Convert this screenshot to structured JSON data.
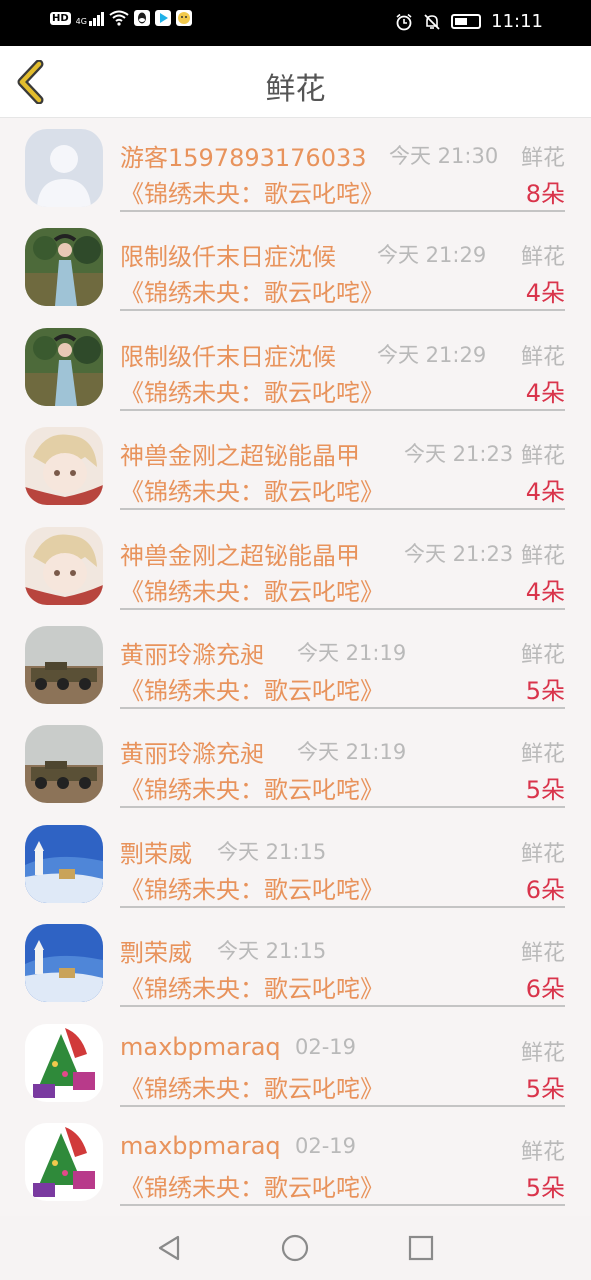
{
  "status_bar": {
    "network_type": "HD",
    "signal_label": "4G",
    "time": "11:11",
    "colors": {
      "qq_icon": "#1d1d1d",
      "video_icon": "#1fb1e8",
      "miniapp_icon": "#f2c94c"
    }
  },
  "header": {
    "title": "鲜花",
    "back_icon": "chevron-left-icon",
    "accent": "#e3bd2d"
  },
  "entries": [
    {
      "avatar": "default-user-avatar",
      "nickname": "游客1597893176033",
      "time": "今天 21:30",
      "gift_type": "鲜花",
      "book": "《锦绣未央：歌云叱咤》",
      "count": "8朵"
    },
    {
      "avatar": "costume-girl-photo-avatar",
      "nickname": "限制级仟末日症沈候",
      "time": "今天 21:29",
      "gift_type": "鲜花",
      "book": "《锦绣未央：歌云叱咤》",
      "count": "4朵"
    },
    {
      "avatar": "costume-girl-photo-avatar",
      "nickname": "限制级仟末日症沈候",
      "time": "今天 21:29",
      "gift_type": "鲜花",
      "book": "《锦绣未央：歌云叱咤》",
      "count": "4朵"
    },
    {
      "avatar": "anime-boy-avatar",
      "nickname": "神兽金刚之超铋能晶甲",
      "time": "今天 21:23",
      "gift_type": "鲜花",
      "book": "《锦绣未央：歌云叱咤》",
      "count": "4朵"
    },
    {
      "avatar": "anime-boy-avatar",
      "nickname": "神兽金刚之超铋能晶甲",
      "time": "今天 21:23",
      "gift_type": "鲜花",
      "book": "《锦绣未央：歌云叱咤》",
      "count": "4朵"
    },
    {
      "avatar": "armored-vehicle-avatar",
      "nickname": "黄丽玲滁充昶",
      "time": "今天 21:19",
      "gift_type": "鲜花",
      "book": "《锦绣未央：歌云叱咤》",
      "count": "5朵"
    },
    {
      "avatar": "armored-vehicle-avatar",
      "nickname": "黄丽玲滁充昶",
      "time": "今天 21:19",
      "gift_type": "鲜花",
      "book": "《锦绣未央：歌云叱咤》",
      "count": "5朵"
    },
    {
      "avatar": "snowy-village-avatar",
      "nickname": "剽荣威",
      "time": "今天 21:15",
      "gift_type": "鲜花",
      "book": "《锦绣未央：歌云叱咤》",
      "count": "6朵"
    },
    {
      "avatar": "snowy-village-avatar",
      "nickname": "剽荣威",
      "time": "今天 21:15",
      "gift_type": "鲜花",
      "book": "《锦绣未央：歌云叱咤》",
      "count": "6朵"
    },
    {
      "avatar": "christmas-tree-avatar",
      "nickname": "maxbpmaraq",
      "time": "02-19",
      "gift_type": "鲜花",
      "book": "《锦绣未央：歌云叱咤》",
      "count": "5朵"
    },
    {
      "avatar": "christmas-tree-avatar",
      "nickname": "maxbpmaraq",
      "time": "02-19",
      "gift_type": "鲜花",
      "book": "《锦绣未央：歌云叱咤》",
      "count": "5朵"
    }
  ],
  "system_nav": {
    "back": "triangle-back-icon",
    "home": "circle-home-icon",
    "recents": "square-recents-icon"
  }
}
